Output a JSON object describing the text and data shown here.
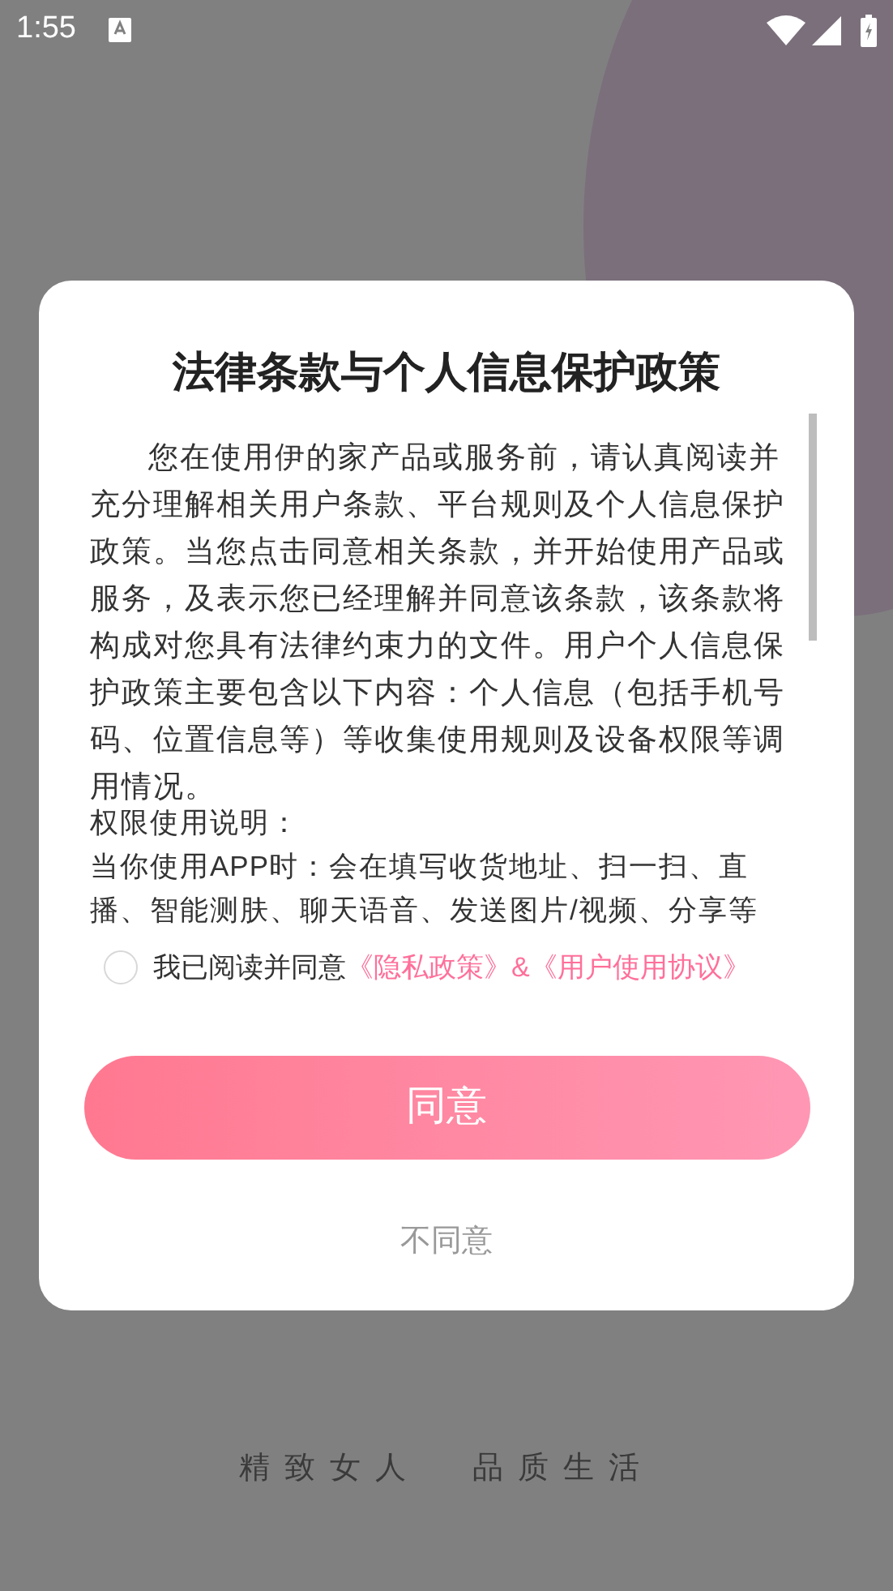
{
  "status_bar": {
    "time": "1:55"
  },
  "dialog": {
    "title": "法律条款与个人信息保护政策",
    "paragraph": "您在使用伊的家产品或服务前，请认真阅读并充分理解相关用户条款、平台规则及个人信息保护政策。当您点击同意相关条款，并开始使用产品或服务，及表示您已经理解并同意该条款，该条款将构成对您具有法律约束力的文件。用户个人信息保护政策主要包含以下内容：个人信息（包括手机号码、位置信息等）等收集使用规则及设备权限等调用情况。",
    "permissions_heading": "权限使用说明：",
    "permissions_text": "当你使用APP时：会在填写收货地址、扫一扫、直播、智能测肤、聊天语音、发送图片/视频、分享等",
    "consent": {
      "checked": false,
      "label": "我已阅读并同意",
      "links": [
        "《隐私政策》",
        "&",
        "《用户使用协议》"
      ]
    },
    "agree_button": "同意",
    "disagree_button": "不同意"
  },
  "slogan": [
    "精致女人",
    "品质生活"
  ]
}
